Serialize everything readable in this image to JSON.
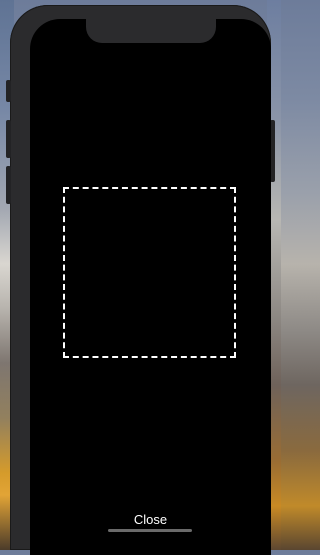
{
  "screen": {
    "close_label": "Close"
  },
  "colors": {
    "screen_background": "#000000",
    "scan_frame": "#ffffff",
    "device_frame": "#2b2b2d"
  },
  "icons": {
    "scan_frame": "dashed-square-scan-frame"
  }
}
